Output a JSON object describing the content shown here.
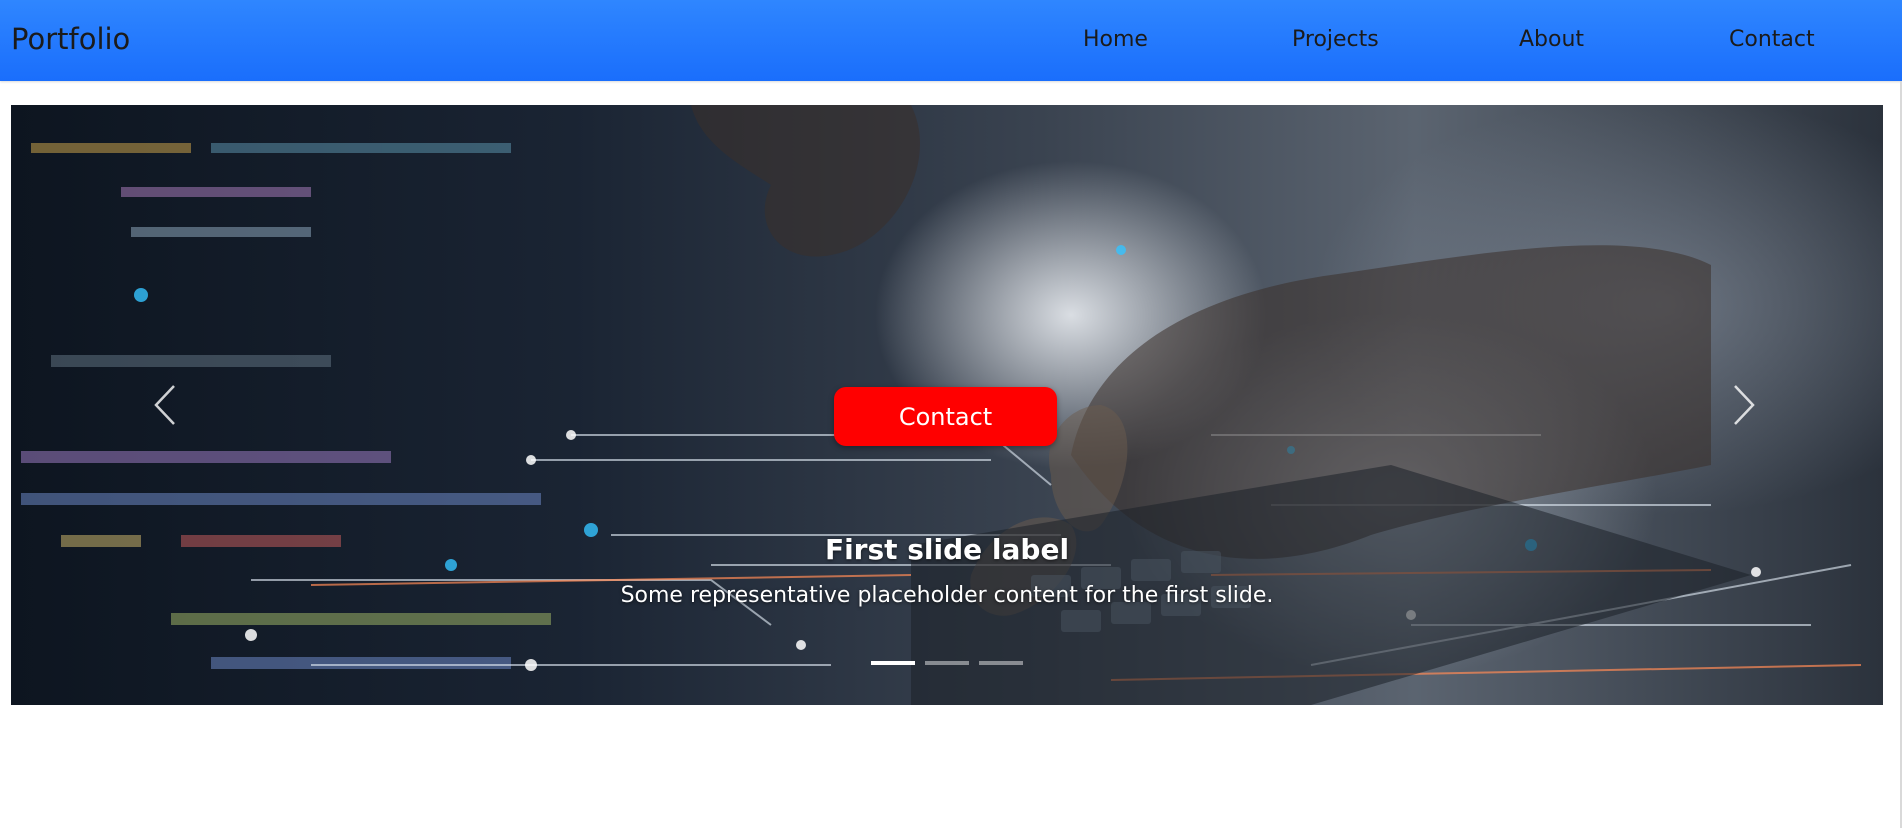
{
  "navbar": {
    "brand": "Portfolio",
    "links": [
      {
        "label": "Home"
      },
      {
        "label": "Projects"
      },
      {
        "label": "About"
      },
      {
        "label": "Contact"
      }
    ],
    "accent_color": "#1a6efc"
  },
  "carousel": {
    "contact_button": {
      "label": "Contact",
      "color": "#ff0000"
    },
    "caption": {
      "title": "First slide label",
      "text": "Some representative placeholder content for the first slide."
    },
    "indicators": {
      "count": 3,
      "active_index": 0
    },
    "controls": {
      "prev_icon": "chevron-left-icon",
      "next_icon": "chevron-right-icon"
    },
    "image": {
      "subject": "hands-typing-on-laptop-with-code-overlay"
    }
  }
}
